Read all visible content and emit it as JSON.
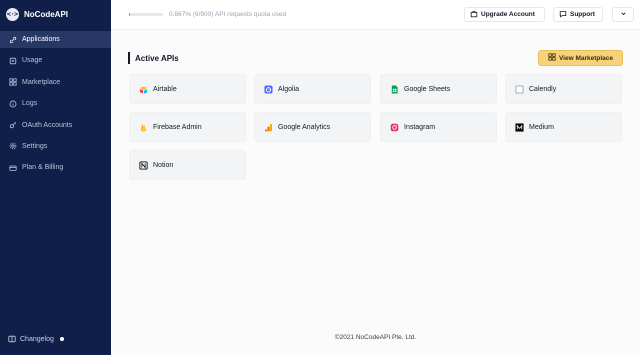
{
  "brand": {
    "name": "NoCodeAPI",
    "logo_text": "<·>"
  },
  "sidebar": {
    "items": [
      {
        "label": "Applications",
        "icon": "link-icon",
        "active": true
      },
      {
        "label": "Usage",
        "icon": "usage-icon",
        "active": false
      },
      {
        "label": "Marketplace",
        "icon": "grid-icon",
        "active": false
      },
      {
        "label": "Logs",
        "icon": "info-icon",
        "active": false
      },
      {
        "label": "OAuth Accounts",
        "icon": "key-icon",
        "active": false
      },
      {
        "label": "Settings",
        "icon": "gear-icon",
        "active": false
      },
      {
        "label": "Plan & Billing",
        "icon": "card-icon",
        "active": false
      }
    ],
    "changelog": "Changelog"
  },
  "topbar": {
    "quota_text": "0.667% (6/900) API requests quota used",
    "quota_percent": 0.667,
    "upgrade_label": "Upgrade Account",
    "support_label": "Support"
  },
  "main": {
    "section_title": "Active APIs",
    "marketplace_label": "View Marketplace",
    "apis": [
      {
        "name": "Airtable",
        "icon": "airtable-icon",
        "color": "#f4b400"
      },
      {
        "name": "Algolia",
        "icon": "algolia-icon",
        "color": "#5468ff"
      },
      {
        "name": "Google Sheets",
        "icon": "google-sheets-icon",
        "color": "#0f9d58"
      },
      {
        "name": "Calendly",
        "icon": "calendly-icon",
        "color": "#9ca3af"
      },
      {
        "name": "Firebase Admin",
        "icon": "firebase-icon",
        "color": "#ffa000"
      },
      {
        "name": "Google Analytics",
        "icon": "google-analytics-icon",
        "color": "#f9ab00"
      },
      {
        "name": "Instagram",
        "icon": "instagram-icon",
        "color": "#e1306c"
      },
      {
        "name": "Medium",
        "icon": "medium-icon",
        "color": "#000000"
      },
      {
        "name": "Notion",
        "icon": "notion-icon",
        "color": "#000000"
      }
    ]
  },
  "footer": {
    "copyright": "©2021 NoCodeAPI Pte. Ltd."
  }
}
